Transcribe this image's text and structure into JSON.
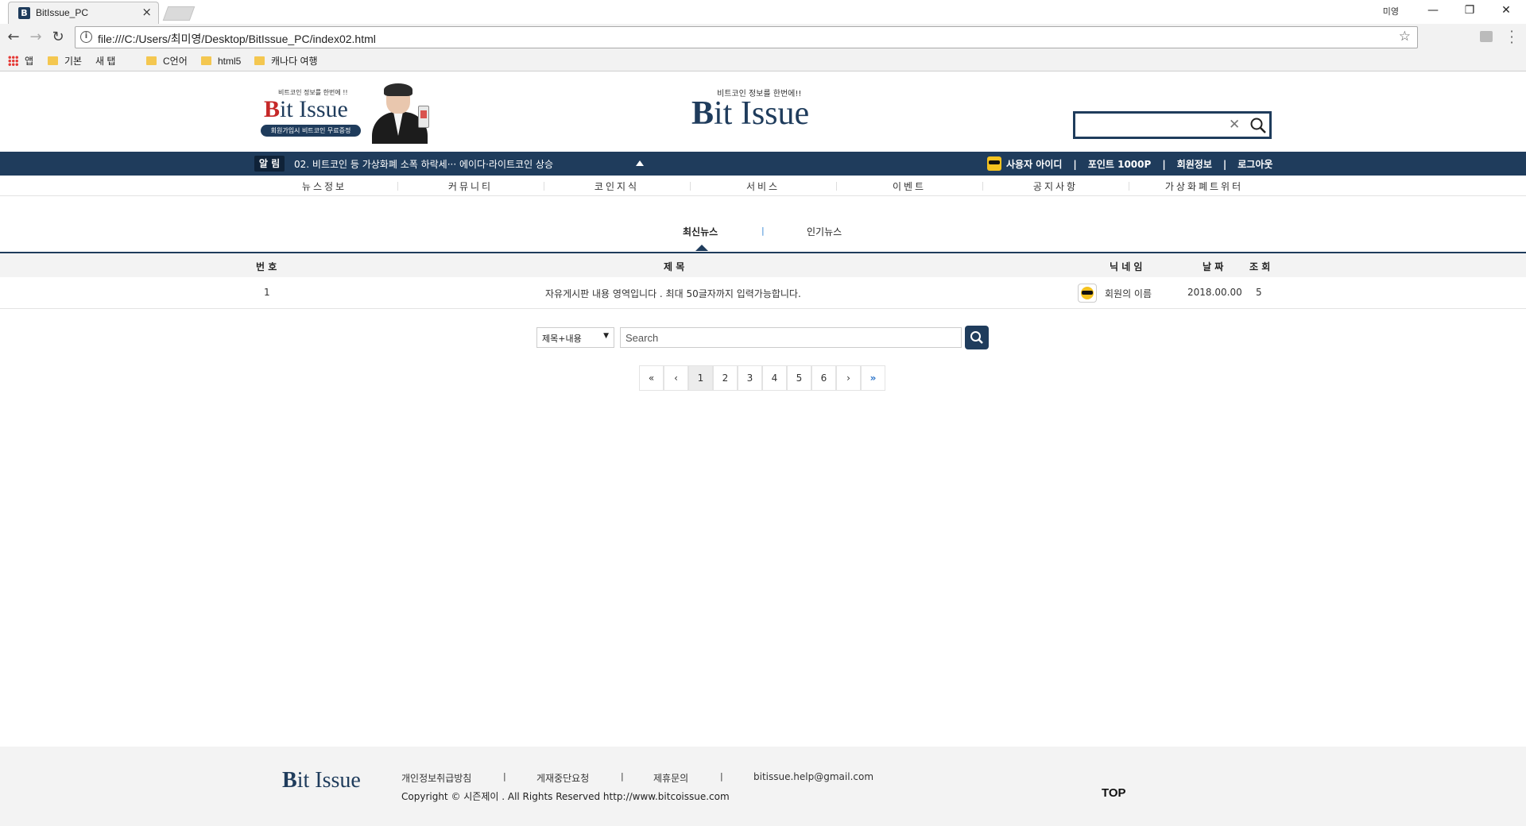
{
  "browser": {
    "tab_title": "BitIssue_PC",
    "profile": "미영",
    "url": "file:///C:/Users/최미영/Desktop/BitIssue_PC/index02.html",
    "bookmarks": [
      "앱",
      "기본",
      "새 탭",
      "C언어",
      "html5",
      "캐나다 여행"
    ]
  },
  "header": {
    "banner_small": "비트코인 정보를 한번에 !!",
    "banner_logo_b": "B",
    "banner_logo_rest": "it Issue",
    "banner_badge": "회원가입시 비트코인 무료증정",
    "main_tag": "비트코인 정보를 한번에!!",
    "main_logo_b": "B",
    "main_logo_rest": "it Issue",
    "search_placeholder": ""
  },
  "notice": {
    "tag": "알 림",
    "text": "02. 비트코인 등 가상화폐 소폭 하락세··· 에이다·라이트코인 상승"
  },
  "user": {
    "id": "사용자 아이디",
    "points": "포인트 1000P",
    "member_info": "회원정보",
    "logout": "로그아웃"
  },
  "gnb": [
    "뉴스정보",
    "커뮤니티",
    "코인지식",
    "서비스",
    "이벤트",
    "공지사항",
    "가상화폐트위터"
  ],
  "subtabs": {
    "latest": "최신뉴스",
    "sep": "|",
    "popular": "인기뉴스"
  },
  "board": {
    "headers": {
      "no": "번 호",
      "title": "제 목",
      "nick": "닉 네 임",
      "date": "날 짜",
      "views": "조 회"
    },
    "rows": [
      {
        "no": "1",
        "title": "자유게시판 내용 영역입니다 . 최대 50글자까지 입력가능합니다.",
        "nick": "회원의 이름",
        "date": "2018.00.00",
        "views": "5"
      }
    ]
  },
  "search": {
    "select_value": "제목+내용",
    "placeholder": "Search"
  },
  "pagination": {
    "first": "«",
    "prev": "‹",
    "pages": [
      "1",
      "2",
      "3",
      "4",
      "5",
      "6"
    ],
    "current": "1",
    "next": "›",
    "last": "»"
  },
  "footer": {
    "logo_b": "B",
    "logo_rest": "it Issue",
    "links": [
      "개인정보취급방침",
      "게재중단요청",
      "제휴문의",
      "bitissue.help@gmail.com"
    ],
    "sep": "|",
    "copyright": "Copyright © 시즌제이 . All Rights Reserved http://www.bitcoissue.com",
    "top": "TOP"
  },
  "colors": {
    "navy": "#1f3c5c",
    "accent_blue": "#3a8ad6",
    "logo_red": "#c62828"
  }
}
